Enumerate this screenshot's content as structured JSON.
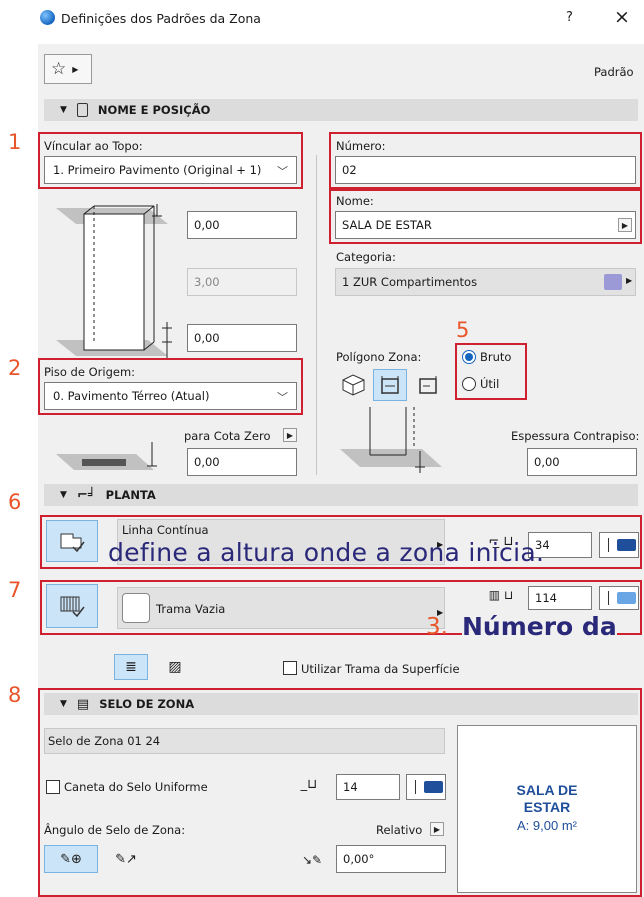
{
  "window": {
    "title": "Definições dos Padrões da Zona",
    "help": "?",
    "close": "×"
  },
  "toolbar": {
    "favorites_icon": "star-icon",
    "default_label": "Padrão"
  },
  "section_name_position": {
    "title": "NOME E POSIÇÃO",
    "link_top_label": "Víncular ao Topo:",
    "link_top_value": "1. Primeiro Pavimento (Original + 1)",
    "top_offset": "0,00",
    "height": "3,00",
    "bottom_offset": "0,00",
    "home_story_label": "Piso de Origem:",
    "home_story_value": "0. Pavimento Térreo (Atual)",
    "to_project_zero_label": "para Cota Zero",
    "to_project_zero_value": "0,00",
    "number_label": "Número:",
    "number_value": "02",
    "name_label": "Nome:",
    "name_value": "SALA DE ESTAR",
    "category_label": "Categoria:",
    "category_value": "1 ZUR  Compartimentos",
    "category_color": "#9b9ad6",
    "polygon_label": "Polígono Zona:",
    "gross_label": "Bruto",
    "net_label": "Útil",
    "floor_thickness_label": "Espessura Contrapiso:",
    "floor_thickness_value": "0,00"
  },
  "section_plan": {
    "title": "PLANTA",
    "line_type": "Linha Contínua",
    "line_pen": "34",
    "fill_name": "Trama Vazia",
    "fill_pen": "114",
    "surface_fill_label": "Utilizar Trama da Superfície",
    "pen_color_line": "#1f4e9b",
    "pen_color_fill": "#6aa6e6"
  },
  "section_stamp": {
    "title": "SELO DE ZONA",
    "stamp_name": "Selo de Zona 01 24",
    "uniform_pen_label": "Caneta do Selo Uniforme",
    "uniform_pen_value": "14",
    "pen_color": "#1f4e9b",
    "angle_label": "Ângulo de Selo de Zona:",
    "relative_label": "Relativo",
    "angle_value": "0,00°",
    "preview_line1": "SALA DE",
    "preview_line2": "ESTAR",
    "preview_area": "A: 9,00 m²"
  },
  "annotations": {
    "n1": "1",
    "n2": "2",
    "n5": "5",
    "n6": "6",
    "n7": "7",
    "n8": "8",
    "caption1": "define a altura onde a zona inicia.",
    "caption2_num": "3.",
    "caption2_text": "Número da"
  }
}
